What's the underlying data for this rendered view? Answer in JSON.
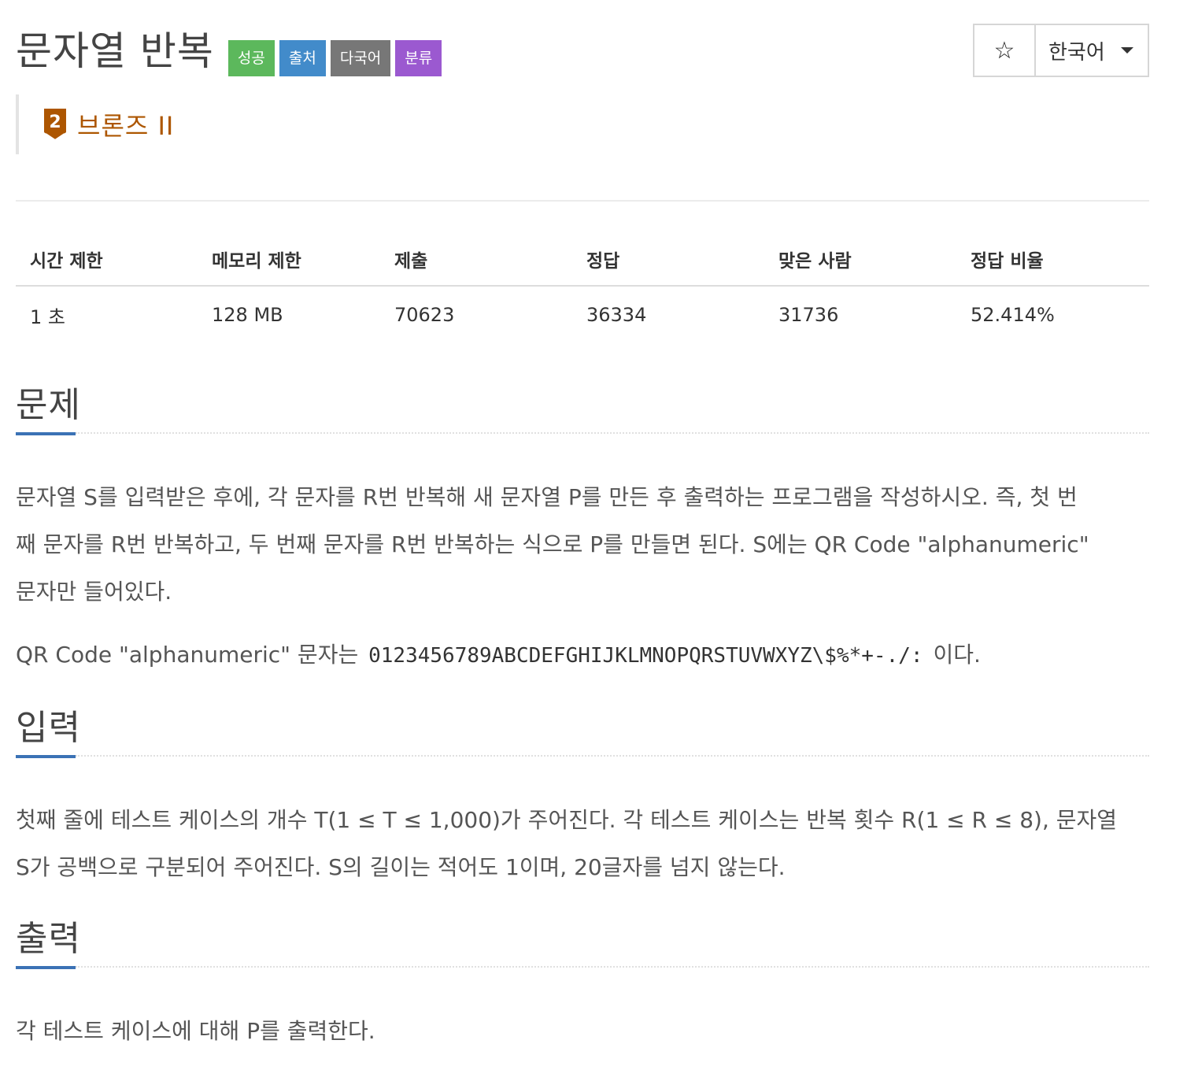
{
  "problem": {
    "title": "문자열 반복",
    "badges": [
      {
        "label": "성공",
        "color": "#5cb85c"
      },
      {
        "label": "출처",
        "color": "#428bca"
      },
      {
        "label": "다국어",
        "color": "#777777"
      },
      {
        "label": "분류",
        "color": "#9b59d0"
      }
    ],
    "tier": {
      "number": "2",
      "label": "브론즈 II",
      "color": "#ad5600"
    }
  },
  "tools": {
    "star_icon": "☆",
    "language": "한국어"
  },
  "stats": {
    "headers": [
      "시간 제한",
      "메모리 제한",
      "제출",
      "정답",
      "맞은 사람",
      "정답 비율"
    ],
    "values": [
      "1 초",
      "128 MB",
      "70623",
      "36334",
      "31736",
      "52.414%"
    ]
  },
  "sections": {
    "description": {
      "title": "문제",
      "lines": [
        "문자열 S를 입력받은 후에, 각 문자를 R번 반복해 새 문자열 P를 만든 후 출력하는 프로그램을 작성하시오. 즉, 첫 번",
        "째 문자를 R번 반복하고, 두 번째 문자를 R번 반복하는 식으로 P를 만들면 된다. S에는 QR Code \"alphanumeric\"",
        "문자만 들어있다."
      ],
      "charset_prefix": "QR Code \"alphanumeric\" 문자는",
      "charset_code": "0123456789ABCDEFGHIJKLMNOPQRSTUVWXYZ\\$%*+-./:",
      "charset_suffix": "이다."
    },
    "input": {
      "title": "입력",
      "lines": [
        "첫째 줄에 테스트 케이스의 개수 T(1 ≤ T ≤ 1,000)가 주어진다. 각 테스트 케이스는 반복 횟수 R(1 ≤ R ≤ 8), 문자열",
        "S가 공백으로 구분되어 주어진다. S의 길이는 적어도 1이며, 20글자를 넘지 않는다."
      ]
    },
    "output": {
      "title": "출력",
      "text": "각 테스트 케이스에 대해 P를 출력한다."
    }
  }
}
